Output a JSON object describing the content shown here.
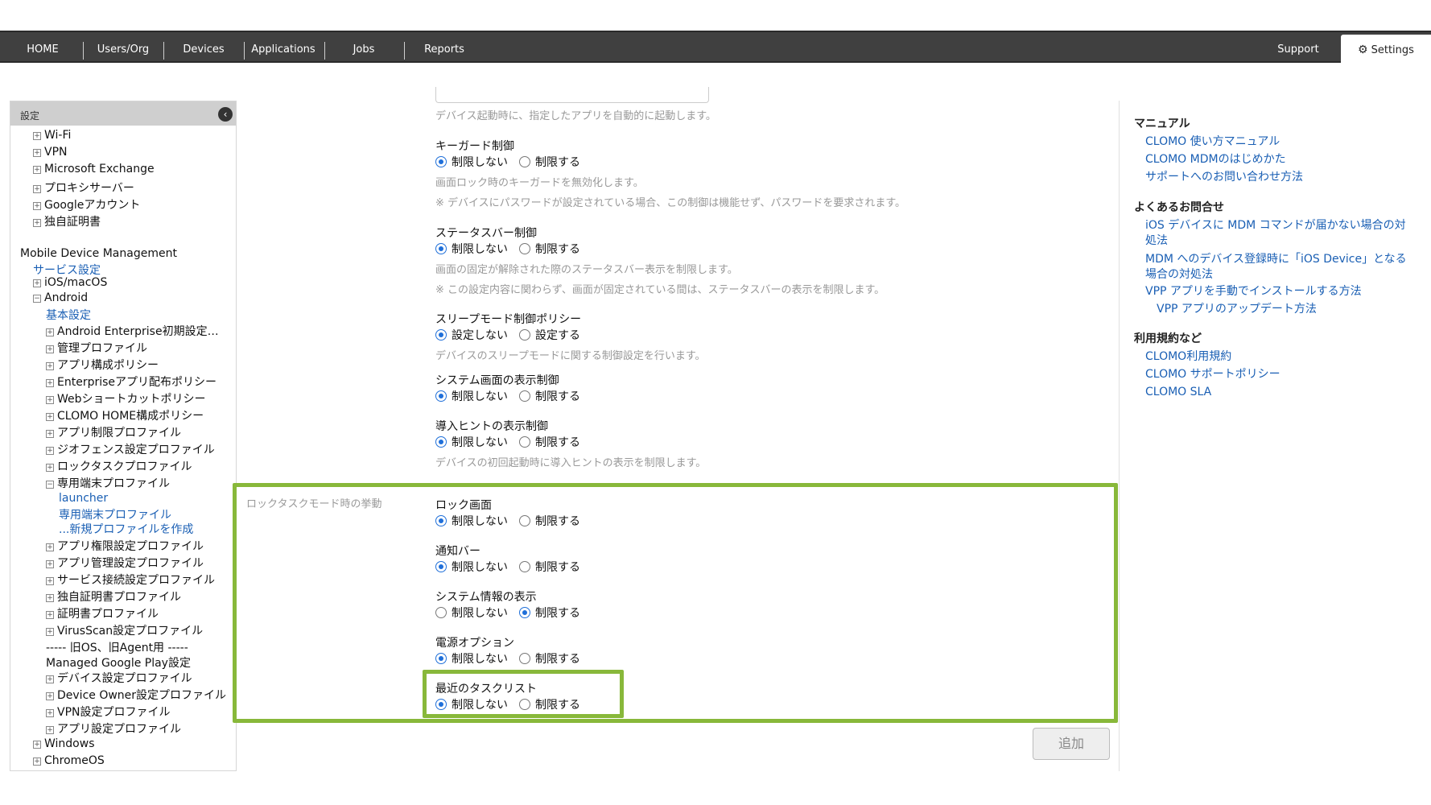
{
  "nav": {
    "items": [
      "HOME",
      "Users/Org",
      "Devices",
      "Applications",
      "Jobs",
      "Reports"
    ],
    "support": "Support",
    "settings": "Settings"
  },
  "sidebar": {
    "header": "設定",
    "lines": [
      {
        "text": "Wi-Fi",
        "pm": "+",
        "indent": 1
      },
      {
        "text": "VPN",
        "pm": "+",
        "indent": 1
      },
      {
        "text": "Microsoft Exchange",
        "pm": "+",
        "indent": 1
      },
      {
        "text": "プロキシサーバー",
        "pm": "+",
        "indent": 1
      },
      {
        "text": "Googleアカウント",
        "pm": "+",
        "indent": 1
      },
      {
        "text": "独自証明書",
        "pm": "+",
        "indent": 1
      },
      {
        "text": "Mobile Device Management",
        "pm": "",
        "indent": 0,
        "gap": true
      },
      {
        "text": "サービス設定",
        "pm": "",
        "indent": 1,
        "link": true
      },
      {
        "text": "iOS/macOS",
        "pm": "+",
        "indent": 1
      },
      {
        "text": "Android",
        "pm": "−",
        "indent": 1
      },
      {
        "text": "基本設定",
        "pm": "",
        "indent": 2,
        "link": true
      },
      {
        "text": "Android Enterprise初期設定…",
        "pm": "+",
        "indent": 2
      },
      {
        "text": "管理プロファイル",
        "pm": "+",
        "indent": 2
      },
      {
        "text": "アプリ構成ポリシー",
        "pm": "+",
        "indent": 2
      },
      {
        "text": "Enterpriseアプリ配布ポリシー",
        "pm": "+",
        "indent": 2
      },
      {
        "text": "Webショートカットポリシー",
        "pm": "+",
        "indent": 2
      },
      {
        "text": "CLOMO HOME構成ポリシー",
        "pm": "+",
        "indent": 2
      },
      {
        "text": "アプリ制限プロファイル",
        "pm": "+",
        "indent": 2
      },
      {
        "text": "ジオフェンス設定プロファイル",
        "pm": "+",
        "indent": 2
      },
      {
        "text": "ロックタスクプロファイル",
        "pm": "+",
        "indent": 2
      },
      {
        "text": "専用端末プロファイル",
        "pm": "−",
        "indent": 2
      },
      {
        "text": "launcher",
        "pm": "",
        "indent": 3,
        "link": true
      },
      {
        "text": "専用端末プロファイル",
        "pm": "",
        "indent": 3,
        "link": true
      },
      {
        "text": "...新規プロファイルを作成",
        "pm": "",
        "indent": 3,
        "link": true
      },
      {
        "text": "アプリ権限設定プロファイル",
        "pm": "+",
        "indent": 2
      },
      {
        "text": "アプリ管理設定プロファイル",
        "pm": "+",
        "indent": 2
      },
      {
        "text": "サービス接続設定プロファイル",
        "pm": "+",
        "indent": 2
      },
      {
        "text": "独自証明書プロファイル",
        "pm": "+",
        "indent": 2
      },
      {
        "text": "証明書プロファイル",
        "pm": "+",
        "indent": 2
      },
      {
        "text": "VirusScan設定プロファイル",
        "pm": "+",
        "indent": 2
      },
      {
        "text": "----- 旧OS、旧Agent用 -----",
        "pm": "",
        "indent": 2
      },
      {
        "text": "Managed Google Play設定",
        "pm": "",
        "indent": 2
      },
      {
        "text": "デバイス設定プロファイル",
        "pm": "+",
        "indent": 2
      },
      {
        "text": "Device Owner設定プロファイル",
        "pm": "+",
        "indent": 2
      },
      {
        "text": "VPN設定プロファイル",
        "pm": "+",
        "indent": 2
      },
      {
        "text": "アプリ設定プロファイル",
        "pm": "+",
        "indent": 2
      },
      {
        "text": "Windows",
        "pm": "+",
        "indent": 1
      },
      {
        "text": "ChromeOS",
        "pm": "+",
        "indent": 1
      }
    ]
  },
  "main": {
    "top_desc": "デバイス起動時に、指定したアプリを自動的に起動します。",
    "settings": [
      {
        "title": "キーガード制御",
        "opt1": "制限しない",
        "opt2": "制限する",
        "selected": 1,
        "desc": "画面ロック時のキーガードを無効化します。",
        "note": "※ デバイスにパスワードが設定されている場合、この制御は機能せず、パスワードを要求されます。"
      },
      {
        "title": "ステータスバー制御",
        "opt1": "制限しない",
        "opt2": "制限する",
        "selected": 1,
        "desc": "画面の固定が解除された際のステータスバー表示を制限します。",
        "note": "※ この設定内容に関わらず、画面が固定されている間は、ステータスバーの表示を制限します。"
      },
      {
        "title": "スリープモード制御ポリシー",
        "opt1": "設定しない",
        "opt2": "設定する",
        "selected": 1,
        "desc": "デバイスのスリープモードに関する制御設定を行います。",
        "note": ""
      },
      {
        "title": "システム画面の表示制御",
        "opt1": "制限しない",
        "opt2": "制限する",
        "selected": 1,
        "desc": "",
        "note": ""
      },
      {
        "title": "導入ヒントの表示制御",
        "opt1": "制限しない",
        "opt2": "制限する",
        "selected": 1,
        "desc": "デバイスの初回起動時に導入ヒントの表示を制限します。",
        "note": ""
      }
    ],
    "lock_group_label": "ロックタスクモード時の挙動",
    "lock_settings": [
      {
        "title": "ロック画面",
        "opt1": "制限しない",
        "opt2": "制限する",
        "selected": 1
      },
      {
        "title": "通知バー",
        "opt1": "制限しない",
        "opt2": "制限する",
        "selected": 1
      },
      {
        "title": "システム情報の表示",
        "opt1": "制限しない",
        "opt2": "制限する",
        "selected": 2
      },
      {
        "title": "電源オプション",
        "opt1": "制限しない",
        "opt2": "制限する",
        "selected": 1
      },
      {
        "title": "最近のタスクリスト",
        "opt1": "制限しない",
        "opt2": "制限する",
        "selected": 1
      }
    ],
    "add_button": "追加",
    "highlight_color": "#88b83a"
  },
  "right": {
    "manual_head": "マニュアル",
    "manual_links": [
      "CLOMO 使い方マニュアル",
      "CLOMO MDMのはじめかた",
      "サポートへのお問い合わせ方法"
    ],
    "faq_head": "よくあるお問合せ",
    "faq_links": [
      [
        "iOS デバイスに MDM コマンドが届かない場合の対",
        "処法"
      ],
      [
        "MDM へのデバイス登録時に「iOS Device」となる",
        "場合の対処法"
      ],
      [
        "VPP アプリを手動でインストールする方法"
      ],
      [
        "VPP アプリのアップデート方法"
      ]
    ],
    "terms_head": "利用規約など",
    "terms_links": [
      "CLOMO利用規約",
      "CLOMO サポートポリシー",
      "CLOMO SLA"
    ]
  }
}
